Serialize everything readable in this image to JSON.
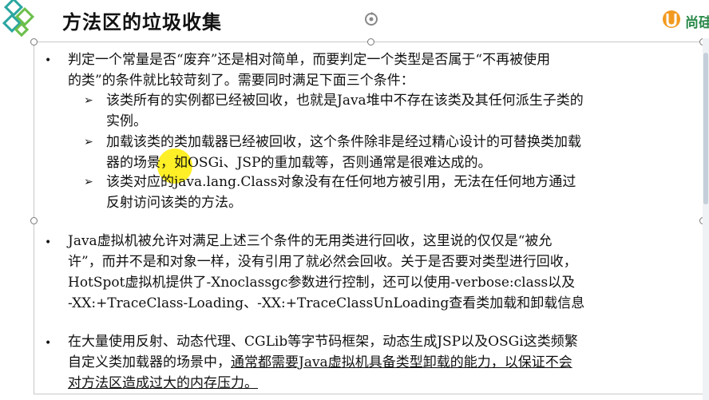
{
  "header": {
    "title": "方法区的垃圾收集",
    "brand": "尚硅"
  },
  "bullets": [
    {
      "lines": [
        "判定一个常量是否“废弃”还是相对简单，而要判定一个类型是否属于“不再被使用",
        "的类”的条件就比较苛刻了。需要同时满足下面三个条件："
      ],
      "subs": [
        {
          "lines": [
            "该类所有的实例都已经被回收，也就是Java堆中不存在该类及其任何派生子类的",
            "实例。"
          ]
        },
        {
          "lines": [
            "加载该类的类加载器已经被回收，这个条件除非是经过精心设计的可替换类加载",
            "器的场景，如OSGi、JSP的重加载等，否则通常是很难达成的。"
          ]
        },
        {
          "lines": [
            "该类对应的java.lang.Class对象没有在任何地方被引用，无法在任何地方通过",
            "反射访问该类的方法。"
          ]
        }
      ]
    },
    {
      "lines": [
        "Java虚拟机被允许对满足上述三个条件的无用类进行回收，这里说的仅仅是“被允",
        "许”，而并不是和对象一样，没有引用了就必然会回收。关于是否要对类型进行回收，",
        "HotSpot虚拟机提供了-Xnoclassgc参数进行控制，还可以使用-verbose:class以及",
        "-XX:+TraceClass-Loading、-XX:+TraceClassUnLoading查看类加载和卸载信息"
      ]
    },
    {
      "lines": [
        "在大量使用反射、动态代理、CGLib等字节码框架，动态生成JSP以及OSGi这类频繁",
        "自定义类加载器的场景中，",
        "对方法区造成过大的内存压力。"
      ],
      "underlined": "通常都需要Java虚拟机具备类型卸载的能力，以保证不会"
    }
  ],
  "colors": {
    "accent": "#2a8a4a",
    "cursor": "#ffec00"
  }
}
